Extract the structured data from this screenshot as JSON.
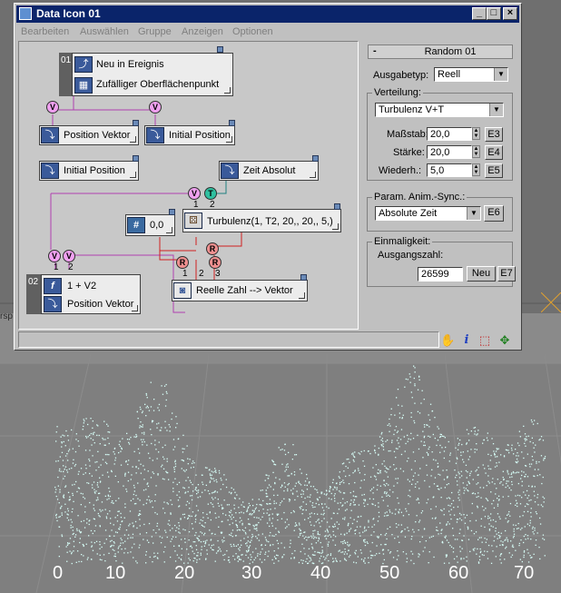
{
  "window": {
    "title": "Data Icon 01"
  },
  "menu": [
    "Bearbeiten",
    "Auswählen",
    "Gruppe",
    "Anzeigen",
    "Optionen"
  ],
  "nodes": {
    "event": {
      "num": "01",
      "line1": "Neu in Ereignis",
      "line2": "Zufälliger Oberflächenpunkt"
    },
    "pos_vektor": "Position Vektor",
    "initial_pos_1": "Initial Position",
    "initial_pos_2": "Initial Position",
    "zeit_absolut": "Zeit Absolut",
    "const_value": "0,0",
    "turbulenz": "Turbulenz(1, T2, 20,, 20,, 5,)",
    "reelle": "Reelle Zahl --> Vektor",
    "output": {
      "num": "02",
      "line1": "1 + V2",
      "line2": "Position Vektor"
    },
    "port_nums": [
      "1",
      "2",
      "1",
      "2",
      "1",
      "2",
      "3"
    ]
  },
  "ports": {
    "v": "V",
    "t": "T",
    "r": "R"
  },
  "panel": {
    "rollout_title": "Random 01",
    "rollout_minus": "-",
    "ausgabetyp_label": "Ausgabetyp:",
    "ausgabetyp_value": "Reell",
    "verteilung_label": "Verteilung:",
    "verteilung_value": "Turbulenz V+T",
    "massstab_label": "Maßstab:",
    "massstab_value": "20,0",
    "massstab_btn": "E3",
    "staerke_label": "Stärke:",
    "staerke_value": "20,0",
    "staerke_btn": "E4",
    "wiederh_label": "Wiederh.:",
    "wiederh_value": "5,0",
    "wiederh_btn": "E5",
    "param_label": "Param. Anim.-Sync.:",
    "param_value": "Absolute Zeit",
    "param_btn": "E6",
    "einmaligkeit_label": "Einmaligkeit:",
    "ausgangszahl_label": "Ausgangszahl:",
    "ausgangszahl_value": "26599",
    "neu_btn": "Neu",
    "neu_btn_e": "E7"
  },
  "viewport": {
    "label": "rsp",
    "axis": [
      "0",
      "10",
      "20",
      "30",
      "40",
      "50",
      "60",
      "70"
    ],
    "particle_color": "#d8fff8"
  }
}
